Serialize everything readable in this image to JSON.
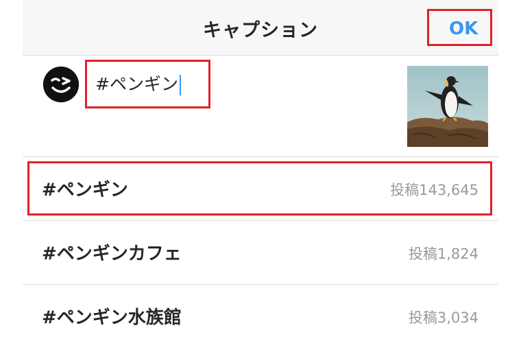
{
  "header": {
    "title": "キャプション",
    "ok_label": "OK"
  },
  "caption": {
    "value": "#ペンギン"
  },
  "suggestions": [
    {
      "tag": "#ペンギン",
      "count": "投稿143,645"
    },
    {
      "tag": "#ペンギンカフェ",
      "count": "投稿1,824"
    },
    {
      "tag": "#ペンギン水族館",
      "count": "投稿3,034"
    }
  ],
  "colors": {
    "accent": "#3897f0",
    "highlight": "#e0202a",
    "count_text": "#999999",
    "header_bg": "#f7f7f7"
  },
  "icons": {
    "avatar": "winking-face-icon",
    "thumbnail": "penguin-photo"
  }
}
